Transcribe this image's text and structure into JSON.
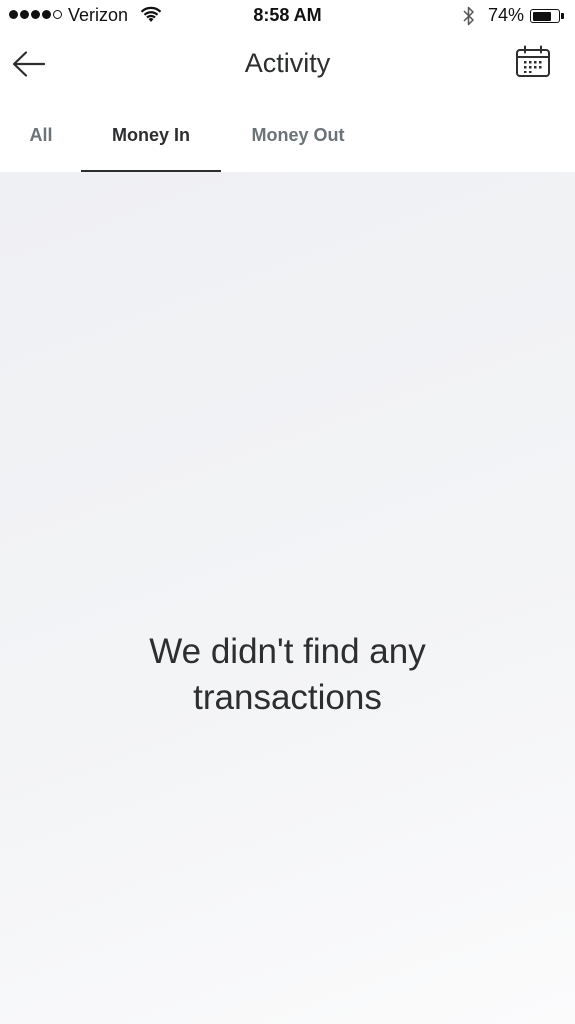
{
  "status_bar": {
    "carrier": "Verizon",
    "time": "8:58 AM",
    "battery_percent": "74%",
    "battery_level": 0.74,
    "signal_bars_filled": 4,
    "signal_bars_total": 5
  },
  "header": {
    "title": "Activity",
    "back_icon": "arrow-left-icon",
    "calendar_icon": "calendar-icon"
  },
  "tabs": [
    {
      "label": "All",
      "active": false
    },
    {
      "label": "Money In",
      "active": true
    },
    {
      "label": "Money Out",
      "active": false
    }
  ],
  "empty_state": {
    "line1": "We didn't find any",
    "line2": "transactions"
  }
}
